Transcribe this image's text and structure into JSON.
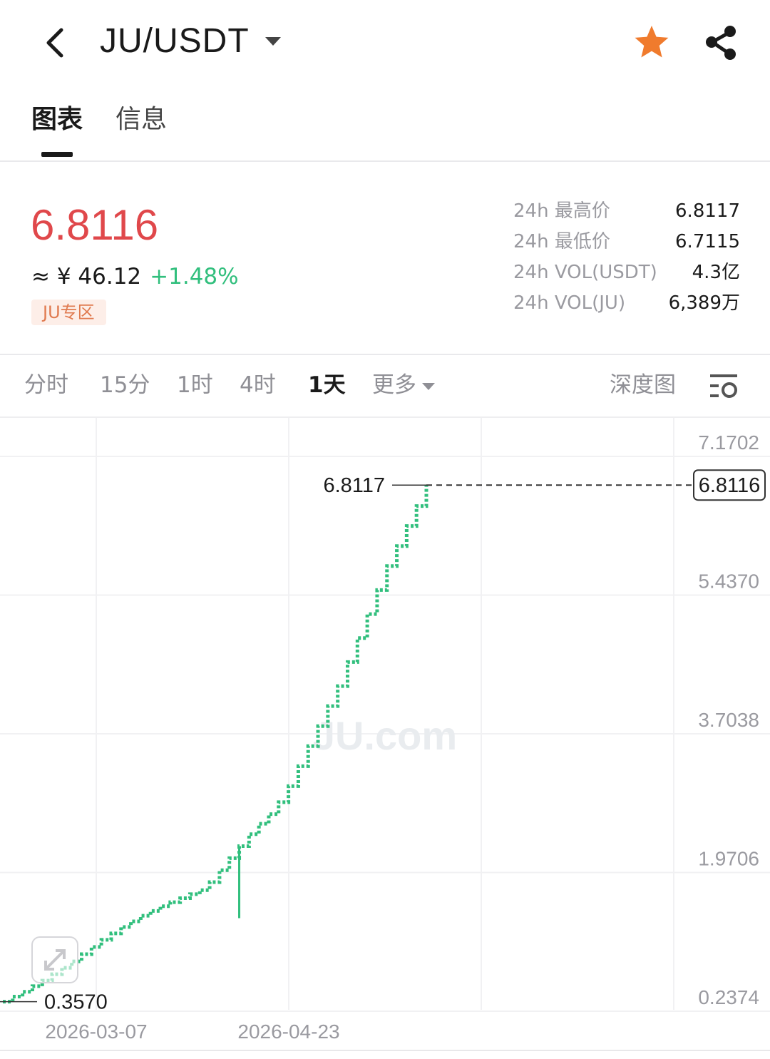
{
  "header": {
    "pair": "JU/USDT",
    "back_icon": "chevron-left-icon",
    "favorite_icon": "star-icon",
    "share_icon": "share-icon",
    "favorite_color": "#f07b2d"
  },
  "tabs": [
    {
      "label": "图表",
      "active": true
    },
    {
      "label": "信息",
      "active": false
    }
  ],
  "ticker": {
    "last_price": "6.8116",
    "cny_approx": "≈ ¥ 46.12",
    "change_pct": "+1.48%",
    "zone_badge": "JU专区",
    "price_color": "#e0484b",
    "change_color": "#31bf7d"
  },
  "stats": [
    {
      "label": "24h 最高价",
      "value": "6.8117"
    },
    {
      "label": "24h 最低价",
      "value": "6.7115"
    },
    {
      "label": "24h VOL(USDT)",
      "value": "4.3亿"
    },
    {
      "label": "24h VOL(JU)",
      "value": "6,389万"
    }
  ],
  "intervals": {
    "items": [
      "分时",
      "15分",
      "1时",
      "4时",
      "1天"
    ],
    "active": "1天",
    "more_label": "更多",
    "depth_label": "深度图",
    "settings_icon": "chart-settings-icon"
  },
  "chart_data": {
    "type": "line",
    "style": "stepped",
    "line_color": "#31bf7d",
    "watermark": "JU.com",
    "y_ticks": [
      "7.1702",
      "5.4370",
      "3.7038",
      "1.9706",
      "0.2374"
    ],
    "ylim": [
      0.2374,
      7.1702
    ],
    "x_ticks": [
      "2026-03-07",
      "2026-04-23"
    ],
    "high_label": "6.8117",
    "low_label": "0.3570",
    "current_price_label": "6.8116",
    "series": [
      {
        "values": [
          0.357,
          0.42,
          0.48,
          0.55,
          0.62,
          0.7,
          0.78,
          0.86,
          0.95,
          1.04,
          1.13,
          1.21,
          1.29,
          1.36,
          1.43,
          1.49,
          1.55,
          1.6,
          1.65,
          1.7,
          1.75,
          1.85,
          2.0,
          2.15,
          2.3,
          2.45,
          2.58,
          2.7,
          2.85,
          3.05,
          3.3,
          3.55,
          3.8,
          4.05,
          4.3,
          4.6,
          4.9,
          5.2,
          5.5,
          5.8,
          6.05,
          6.3,
          6.55,
          6.8117
        ],
        "wick_low": {
          "index": 24,
          "value": 1.4
        }
      }
    ]
  }
}
